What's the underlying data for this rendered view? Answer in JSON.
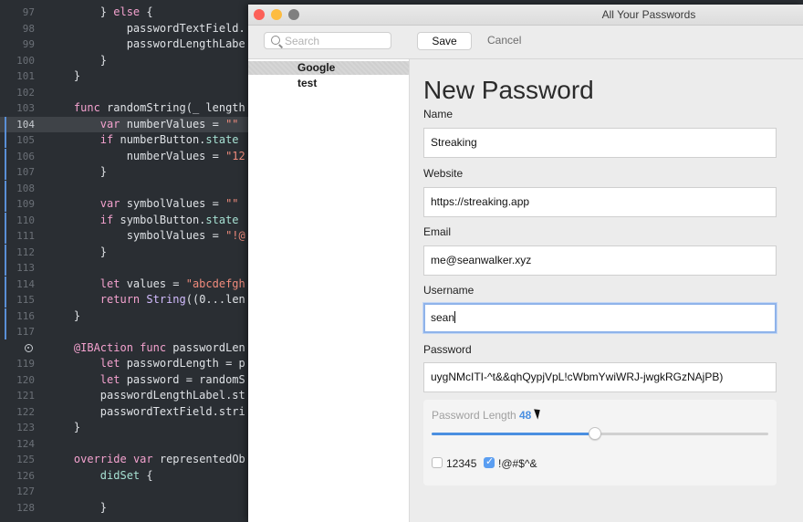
{
  "editor": {
    "lines": [
      {
        "num": "97",
        "code": "        } else {"
      },
      {
        "num": "98",
        "code": "            passwordTextField."
      },
      {
        "num": "99",
        "code": "            passwordLengthLabe"
      },
      {
        "num": "100",
        "code": "        }"
      },
      {
        "num": "101",
        "code": "    }"
      },
      {
        "num": "102",
        "code": ""
      },
      {
        "num": "103",
        "code": "    func randomString(_ length"
      },
      {
        "num": "104",
        "code": "        var numberValues = \"\""
      },
      {
        "num": "105",
        "code": "        if numberButton.state"
      },
      {
        "num": "106",
        "code": "            numberValues = \"12"
      },
      {
        "num": "107",
        "code": "        }"
      },
      {
        "num": "108",
        "code": ""
      },
      {
        "num": "109",
        "code": "        var symbolValues = \"\""
      },
      {
        "num": "110",
        "code": "        if symbolButton.state"
      },
      {
        "num": "111",
        "code": "            symbolValues = \"!@"
      },
      {
        "num": "112",
        "code": "        }"
      },
      {
        "num": "113",
        "code": ""
      },
      {
        "num": "114",
        "code": "        let values = \"abcdefgh"
      },
      {
        "num": "115",
        "code": "        return String((0...len"
      },
      {
        "num": "116",
        "code": "    }"
      },
      {
        "num": "117",
        "code": ""
      },
      {
        "num": "",
        "code": "    @IBAction func passwordLen"
      },
      {
        "num": "119",
        "code": "        let passwordLength = p"
      },
      {
        "num": "120",
        "code": "        let password = randomS"
      },
      {
        "num": "121",
        "code": "        passwordLengthLabel.st"
      },
      {
        "num": "122",
        "code": "        passwordTextField.stri"
      },
      {
        "num": "123",
        "code": "    }"
      },
      {
        "num": "124",
        "code": ""
      },
      {
        "num": "125",
        "code": "    override var representedOb"
      },
      {
        "num": "126",
        "code": "        didSet {"
      },
      {
        "num": "127",
        "code": ""
      },
      {
        "num": "128",
        "code": "        }"
      }
    ]
  },
  "window": {
    "title": "All Your Passwords",
    "search": {
      "placeholder": "Search"
    },
    "save_label": "Save",
    "cancel_label": "Cancel"
  },
  "sidebar": {
    "items": [
      {
        "label": "Google",
        "selected": true
      },
      {
        "label": "test",
        "selected": false
      }
    ]
  },
  "form": {
    "title": "New Password",
    "name_label": "Name",
    "name_value": "Streaking",
    "website_label": "Website",
    "website_value": "https://streaking.app",
    "email_label": "Email",
    "email_value": "me@seanwalker.xyz",
    "username_label": "Username",
    "username_value": "sean",
    "password_label": "Password",
    "password_value": "uygNMcITI-^t&&qhQypjVpL!cWbmYwiWRJ-jwgkRGzNAjPB)",
    "length_label": "Password Length",
    "length_value": "48",
    "slider_fraction": 0.485,
    "numbers_label": "12345",
    "numbers_checked": false,
    "symbols_label": "!@#$^&",
    "symbols_checked": true
  }
}
